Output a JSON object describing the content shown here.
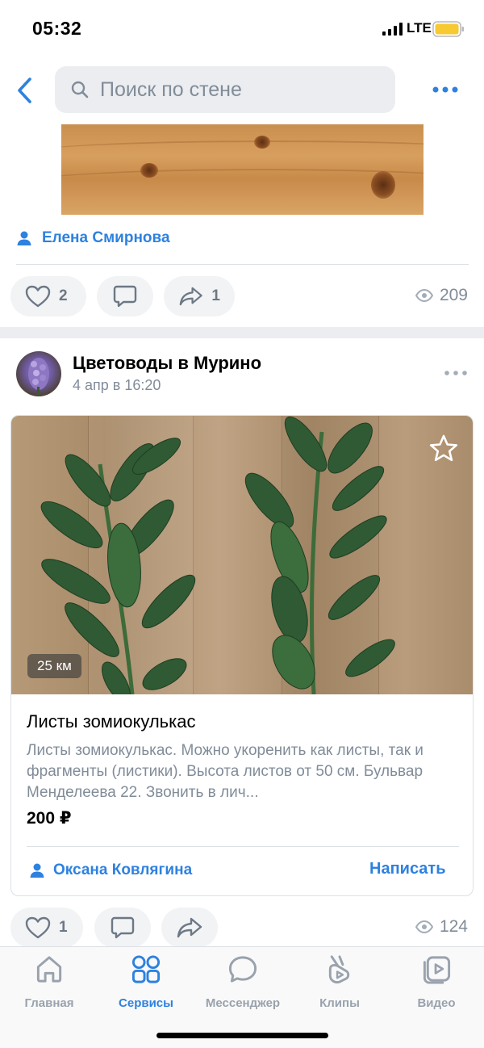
{
  "status_bar": {
    "time": "05:32",
    "network": "LTE",
    "icons": [
      "signal-icon",
      "battery-icon"
    ]
  },
  "header": {
    "search_placeholder": "Поиск по стене",
    "icons": [
      "back-arrow-icon",
      "search-icon",
      "more-dots-icon"
    ]
  },
  "top_post": {
    "author": "Елена Смирнова",
    "likes": "2",
    "reposts": "1",
    "views": "209"
  },
  "group_post": {
    "group_name": "Цветоводы в Мурино",
    "date": "4 апр в 16:20",
    "distance": "25 км",
    "title": "Листы зомиокулькас",
    "description": "Листы зомиокулькас. Можно укоренить как листы, так и фрагменты (листики). Высота листов от 50 см. Бульвар Менделеева 22. Звонить в лич...",
    "price": "200 ₽",
    "seller": "Оксана Ковлягина",
    "write_label": "Написать",
    "likes": "1",
    "views": "124"
  },
  "tabbar": {
    "tabs": [
      {
        "label": "Главная",
        "icon": "home-icon",
        "active": false
      },
      {
        "label": "Сервисы",
        "icon": "services-grid-icon",
        "active": true
      },
      {
        "label": "Мессенджер",
        "icon": "messenger-bubble-icon",
        "active": false
      },
      {
        "label": "Клипы",
        "icon": "clips-icon",
        "active": false
      },
      {
        "label": "Видео",
        "icon": "video-play-icon",
        "active": false
      }
    ]
  },
  "colors": {
    "accent": "#2d81e0",
    "secondary_text": "#818c99",
    "pill_bg": "#f2f3f5",
    "tab_inactive": "#99a2ad"
  }
}
